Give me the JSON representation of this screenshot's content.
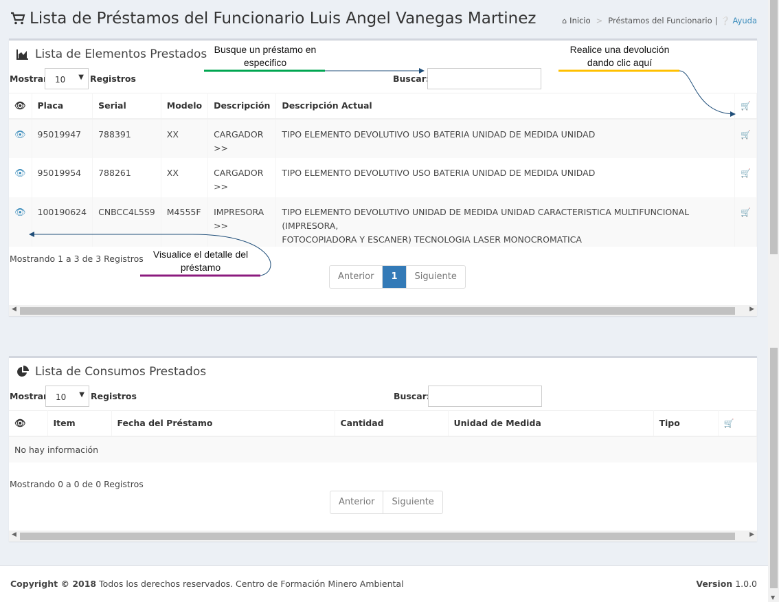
{
  "header": {
    "title": "Lista de Préstamos del Funcionario Luis Angel Vanegas Martinez",
    "breadcrumb": {
      "home": "Inicio",
      "current": "Préstamos del Funcionario",
      "separator": "|",
      "help": "Ayuda"
    }
  },
  "elements_box": {
    "title": "Lista de Elementos Prestados",
    "show_label": "Mostrar",
    "page_size": "10",
    "records_label": "Registros",
    "search_label": "Buscar:",
    "search_value": "",
    "columns": [
      "Placa",
      "Serial",
      "Modelo",
      "Descripción",
      "Descripción Actual"
    ],
    "rows": [
      {
        "placa": "95019947",
        "serial": "788391",
        "modelo": "XX",
        "descripcion": "CARGADOR",
        "descripcion_more": ">>",
        "descripcion_actual": "TIPO ELEMENTO DEVOLUTIVO USO BATERIA UNIDAD DE MEDIDA UNIDAD",
        "descripcion_actual_2": ""
      },
      {
        "placa": "95019954",
        "serial": "788261",
        "modelo": "XX",
        "descripcion": "CARGADOR",
        "descripcion_more": ">>",
        "descripcion_actual": "TIPO ELEMENTO DEVOLUTIVO USO BATERIA UNIDAD DE MEDIDA UNIDAD",
        "descripcion_actual_2": ""
      },
      {
        "placa": "100190624",
        "serial": "CNBCC4L5S9",
        "modelo": "M4555F",
        "descripcion": "IMPRESORA",
        "descripcion_more": ">>",
        "descripcion_actual": "TIPO ELEMENTO DEVOLUTIVO UNIDAD DE MEDIDA UNIDAD CARACTERISTICA MULTIFUNCIONAL (IMPRESORA,",
        "descripcion_actual_2": "FOTOCOPIADORA Y ESCANER) TECNOLOGIA LASER MONOCROMATICA"
      }
    ],
    "info": "Mostrando 1 a 3 de 3 Registros",
    "pagination": {
      "prev": "Anterior",
      "current": "1",
      "next": "Siguiente"
    }
  },
  "consumos_box": {
    "title": "Lista de Consumos Prestados",
    "show_label": "Mostrar",
    "page_size": "10",
    "records_label": "Registros",
    "search_label": "Buscar:",
    "search_value": "",
    "columns": [
      "Item",
      "Fecha del Préstamo",
      "Cantidad",
      "Unidad de Medida",
      "Tipo"
    ],
    "empty": "No hay información",
    "info": "Mostrando 0 a 0 de 0 Registros",
    "pagination": {
      "prev": "Anterior",
      "next": "Siguiente"
    }
  },
  "annotations": {
    "search": [
      "Busque un préstamo en",
      "especifico"
    ],
    "return": [
      "Realice una devolución",
      "dando clic aquí"
    ],
    "detail": [
      "Visualice el detalle del",
      "préstamo"
    ],
    "colors": {
      "search": "#00a651",
      "return": "#ffc000",
      "detail": "#8b1a7e",
      "arrow": "#1f4e79"
    }
  },
  "footer": {
    "copyright_bold": "Copyright © 2018",
    "copyright_text": "Todos los derechos reservados. Centro de Formación Minero Ambiental",
    "version_label": "Version",
    "version": "1.0.0"
  },
  "icons": {
    "title": "cart-icon",
    "home": "home-icon",
    "help": "question-circle-icon",
    "elements": "area-chart-icon",
    "consumos": "pie-chart-icon",
    "view": "eye-icon",
    "return": "cart-arrow-icon"
  }
}
